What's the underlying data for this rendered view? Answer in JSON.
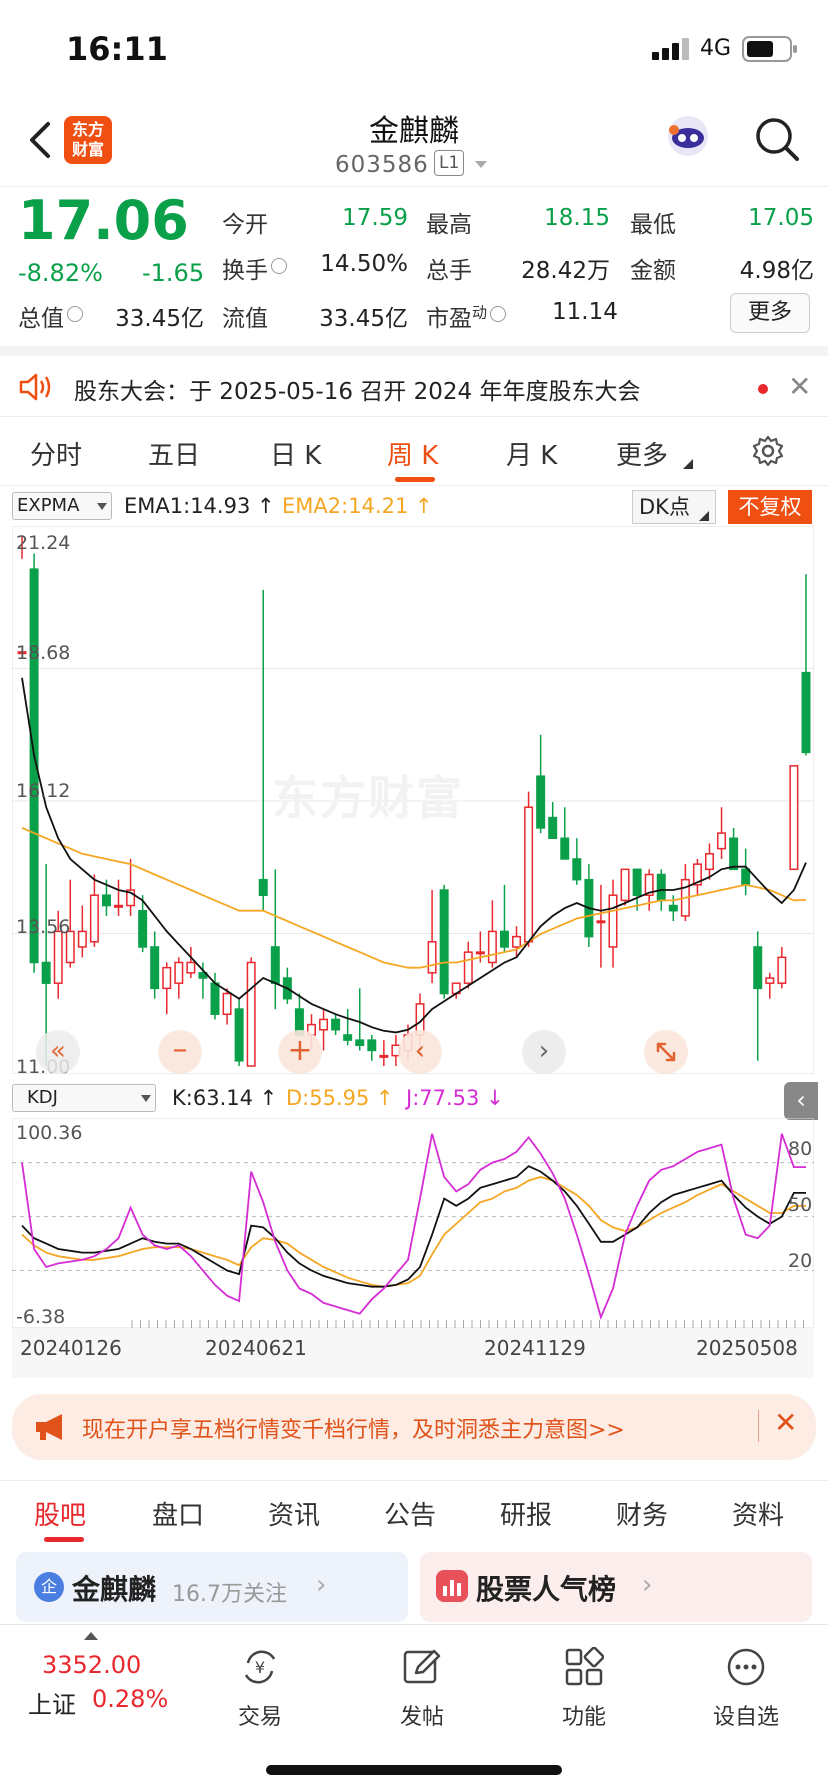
{
  "status_bar": {
    "time": "16:11",
    "network": "4G"
  },
  "header": {
    "title": "金麒麟",
    "code": "603586",
    "level": "L1",
    "logo_text": [
      "东方",
      "财富"
    ]
  },
  "quote": {
    "price": "17.06",
    "change_pct": "-8.82%",
    "change": "-1.65",
    "open_label": "今开",
    "open": "17.59",
    "high_label": "最高",
    "high": "18.15",
    "low_label": "最低",
    "low": "17.05",
    "turnover_label": "换手",
    "turnover": "14.50%",
    "volume_label": "总手",
    "volume": "28.42万",
    "amount_label": "金额",
    "amount": "4.98亿",
    "mktcap_label": "总值",
    "mktcap": "33.45亿",
    "float_label": "流值",
    "float": "33.45亿",
    "pe_label": "市盈",
    "pe_sup": "动",
    "pe": "11.14",
    "more": "更多"
  },
  "notice": {
    "text": "股东大会：于 2025-05-16 召开 2024 年年度股东大会"
  },
  "period_tabs": [
    "分时",
    "五日",
    "日 K",
    "周 K",
    "月 K",
    "更多"
  ],
  "active_period": "周 K",
  "main_indicator": {
    "selector": "EXPMA",
    "ema1": "EMA1:14.93",
    "ema2": "EMA2:14.21",
    "dk_label": "DK点",
    "rights_label": "不复权",
    "watermark": "东方财富",
    "y_ticks": [
      "21.24",
      "18.68",
      "16.12",
      "13.56",
      "11.00"
    ]
  },
  "sub_indicator": {
    "selector": "KDJ",
    "k": "K:63.14",
    "d": "D:55.95",
    "j": "J:77.53",
    "y_ticks": [
      "100.36",
      "-6.38"
    ],
    "right_ticks": [
      "80",
      "50",
      "20"
    ]
  },
  "x_dates": [
    "20240126",
    "20240621",
    "20241129",
    "20250508"
  ],
  "colors": {
    "up": "#e8282d",
    "down": "#0aa04a",
    "ema1": "#111111",
    "ema2": "#f5a623",
    "j_line": "#d52cd5",
    "accent": "#f04f12"
  },
  "chart_data": {
    "type": "candlestick",
    "title": "",
    "ylim": [
      11.0,
      21.24
    ],
    "candles": [
      [
        19.0,
        21.24,
        20.8,
        19.0
      ],
      [
        20.6,
        20.9,
        12.8,
        13.0
      ],
      [
        13.0,
        14.9,
        11.0,
        12.6
      ],
      [
        12.6,
        14.0,
        12.3,
        13.6
      ],
      [
        13.0,
        14.6,
        12.9,
        13.6
      ],
      [
        13.3,
        14.1,
        13.1,
        13.6
      ],
      [
        13.4,
        14.7,
        13.3,
        14.3
      ],
      [
        14.3,
        14.6,
        13.9,
        14.1
      ],
      [
        14.1,
        14.6,
        13.9,
        14.1
      ],
      [
        14.1,
        15.0,
        13.9,
        14.4
      ],
      [
        14.0,
        14.3,
        13.2,
        13.3
      ],
      [
        13.3,
        13.6,
        12.3,
        12.5
      ],
      [
        12.5,
        13.0,
        12.0,
        12.9
      ],
      [
        12.6,
        13.1,
        12.3,
        13.0
      ],
      [
        12.8,
        13.3,
        12.7,
        13.0
      ],
      [
        12.8,
        13.0,
        12.3,
        12.7
      ],
      [
        12.6,
        12.8,
        11.9,
        12.0
      ],
      [
        12.0,
        12.5,
        11.8,
        12.4
      ],
      [
        12.1,
        12.3,
        11.0,
        11.1
      ],
      [
        11.0,
        13.1,
        11.0,
        13.0
      ],
      [
        14.6,
        20.2,
        14.0,
        14.3
      ],
      [
        13.3,
        14.8,
        12.1,
        12.6
      ],
      [
        12.7,
        12.9,
        12.2,
        12.3
      ],
      [
        12.1,
        12.4,
        11.6,
        11.6
      ],
      [
        11.6,
        12.0,
        11.3,
        11.8
      ],
      [
        11.7,
        12.1,
        11.3,
        11.9
      ],
      [
        11.9,
        12.0,
        11.6,
        11.7
      ],
      [
        11.6,
        12.1,
        11.4,
        11.5
      ],
      [
        11.5,
        12.5,
        11.3,
        11.4
      ],
      [
        11.5,
        11.6,
        11.1,
        11.3
      ],
      [
        11.2,
        11.5,
        11.0,
        11.2
      ],
      [
        11.2,
        11.6,
        11.0,
        11.4
      ],
      [
        11.3,
        11.8,
        11.1,
        11.6
      ],
      [
        11.6,
        12.4,
        11.2,
        12.2
      ],
      [
        12.8,
        14.4,
        12.6,
        13.4
      ],
      [
        14.4,
        14.5,
        12.3,
        12.4
      ],
      [
        12.4,
        12.6,
        12.3,
        12.6
      ],
      [
        12.6,
        13.4,
        12.5,
        13.2
      ],
      [
        13.2,
        13.6,
        13.0,
        13.2
      ],
      [
        13.0,
        14.2,
        12.9,
        13.6
      ],
      [
        13.6,
        14.5,
        13.2,
        13.3
      ],
      [
        13.3,
        13.7,
        13.1,
        13.5
      ],
      [
        13.4,
        16.3,
        13.3,
        16.0
      ],
      [
        16.6,
        17.4,
        15.5,
        15.6
      ],
      [
        15.8,
        16.1,
        15.4,
        15.4
      ],
      [
        15.4,
        16.0,
        15.0,
        15.0
      ],
      [
        15.0,
        15.4,
        14.5,
        14.6
      ],
      [
        14.6,
        14.9,
        13.3,
        13.5
      ],
      [
        13.8,
        14.5,
        12.9,
        13.8
      ],
      [
        13.3,
        14.6,
        12.9,
        14.3
      ],
      [
        14.2,
        14.8,
        14.1,
        14.8
      ],
      [
        14.8,
        14.8,
        14.0,
        14.3
      ],
      [
        14.3,
        14.8,
        14.0,
        14.7
      ],
      [
        14.7,
        14.8,
        14.0,
        14.2
      ],
      [
        14.1,
        14.3,
        13.8,
        14.0
      ],
      [
        13.9,
        14.9,
        13.8,
        14.6
      ],
      [
        14.5,
        15.0,
        14.3,
        14.9
      ],
      [
        14.8,
        15.3,
        14.6,
        15.1
      ],
      [
        15.2,
        16.0,
        15.0,
        15.5
      ],
      [
        15.4,
        15.6,
        14.8,
        14.8
      ],
      [
        14.8,
        15.2,
        14.3,
        14.5
      ],
      [
        13.3,
        13.6,
        11.1,
        12.5
      ],
      [
        12.6,
        12.8,
        12.3,
        12.7
      ],
      [
        12.6,
        13.3,
        12.5,
        13.1
      ],
      [
        14.8,
        16.8,
        14.8,
        16.8
      ],
      [
        18.6,
        20.5,
        17.0,
        17.06
      ]
    ],
    "ema1": [
      18.5,
      17.0,
      16.0,
      15.4,
      15.0,
      14.8,
      14.6,
      14.5,
      14.4,
      14.35,
      14.2,
      13.9,
      13.6,
      13.35,
      13.1,
      12.85,
      12.6,
      12.45,
      12.3,
      12.5,
      12.7,
      12.6,
      12.5,
      12.35,
      12.2,
      12.1,
      12.0,
      11.92,
      11.85,
      11.75,
      11.68,
      11.65,
      11.7,
      11.85,
      12.1,
      12.25,
      12.4,
      12.55,
      12.7,
      12.85,
      13.0,
      13.1,
      13.4,
      13.7,
      13.9,
      14.05,
      14.15,
      14.05,
      14.0,
      14.05,
      14.15,
      14.25,
      14.35,
      14.4,
      14.4,
      14.45,
      14.55,
      14.65,
      14.8,
      14.85,
      14.85,
      14.6,
      14.35,
      14.15,
      14.4,
      14.93
    ],
    "ema2": [
      15.6,
      15.5,
      15.4,
      15.3,
      15.2,
      15.1,
      15.05,
      15.0,
      14.95,
      14.9,
      14.8,
      14.7,
      14.6,
      14.5,
      14.4,
      14.3,
      14.2,
      14.1,
      14.0,
      14.0,
      14.0,
      13.9,
      13.8,
      13.7,
      13.6,
      13.5,
      13.4,
      13.3,
      13.2,
      13.1,
      13.0,
      12.95,
      12.9,
      12.9,
      12.95,
      13.0,
      13.0,
      13.05,
      13.1,
      13.15,
      13.2,
      13.25,
      13.4,
      13.55,
      13.65,
      13.75,
      13.85,
      13.9,
      13.95,
      14.0,
      14.05,
      14.1,
      14.15,
      14.2,
      14.2,
      14.25,
      14.3,
      14.35,
      14.4,
      14.45,
      14.5,
      14.45,
      14.4,
      14.3,
      14.2,
      14.21
    ],
    "kdj_ylim": [
      -6.38,
      100.36
    ],
    "kdj_k": [
      45,
      38,
      35,
      32,
      31,
      30,
      30,
      31,
      32,
      35,
      38,
      36,
      35,
      35,
      32,
      28,
      24,
      20,
      18,
      45,
      44,
      38,
      30,
      24,
      20,
      17,
      15,
      13,
      12,
      11,
      11,
      12,
      15,
      22,
      40,
      60,
      56,
      60,
      66,
      68,
      70,
      72,
      78,
      75,
      70,
      64,
      56,
      46,
      36,
      36,
      40,
      44,
      52,
      58,
      62,
      64,
      66,
      68,
      70,
      62,
      55,
      50,
      46,
      50,
      63.14,
      63.14
    ],
    "kdj_d": [
      40,
      34,
      30,
      28,
      27,
      26,
      26,
      27,
      28,
      30,
      32,
      33,
      33,
      33,
      32,
      30,
      28,
      26,
      23,
      33,
      38,
      37,
      35,
      30,
      26,
      22,
      19,
      16,
      14,
      12,
      11,
      12,
      13,
      17,
      29,
      40,
      46,
      52,
      58,
      60,
      64,
      66,
      70,
      72,
      70,
      66,
      62,
      56,
      48,
      44,
      42,
      44,
      48,
      52,
      55,
      58,
      62,
      65,
      68,
      64,
      60,
      56,
      52,
      52,
      55.95,
      55.95
    ],
    "kdj_j": [
      80,
      32,
      22,
      24,
      25,
      26,
      28,
      32,
      38,
      55,
      40,
      34,
      32,
      34,
      28,
      20,
      12,
      6,
      3,
      75,
      58,
      36,
      20,
      10,
      7,
      2,
      0,
      -2,
      -4,
      4,
      10,
      18,
      26,
      60,
      96,
      72,
      64,
      68,
      76,
      80,
      82,
      86,
      94,
      85,
      74,
      60,
      40,
      18,
      -6,
      10,
      40,
      56,
      70,
      76,
      78,
      82,
      86,
      88,
      90,
      60,
      40,
      38,
      45,
      96,
      77.53,
      77.53
    ]
  },
  "ad_banner": {
    "text": "现在开户享五档行情变千档行情，及时洞悉主力意图>>"
  },
  "bottom_tabs": [
    "股吧",
    "盘口",
    "资讯",
    "公告",
    "研报",
    "财务",
    "资料"
  ],
  "cards": {
    "stock_name": "金麒麟",
    "followers": "16.7万关注",
    "rank": "股票人气榜"
  },
  "bottom_nav": {
    "index_value": "3352.00",
    "index_name": "上证",
    "index_pct": "0.28%",
    "items": [
      "交易",
      "发帖",
      "功能",
      "设自选"
    ]
  }
}
